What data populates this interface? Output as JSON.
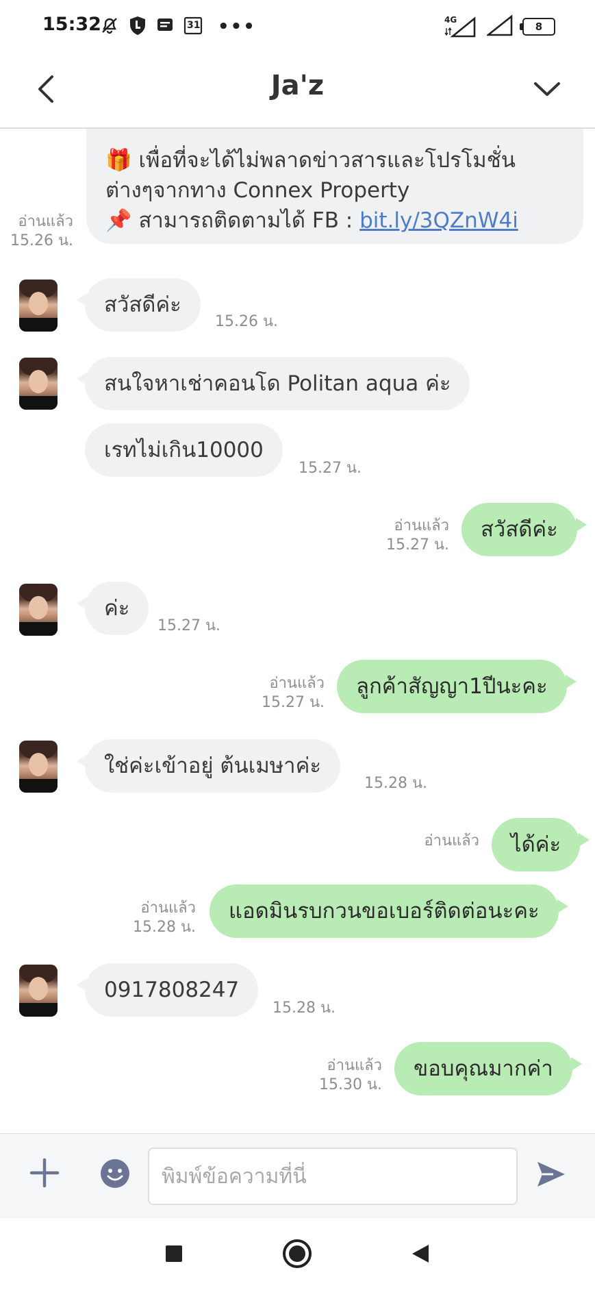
{
  "status_bar": {
    "time": "15:32",
    "left_icons": [
      "mute-icon",
      "shield-icon",
      "message-icon",
      "calendar-icon"
    ],
    "calendar_day": "31",
    "more": "•••",
    "network": "4G",
    "battery": "8"
  },
  "header": {
    "title": "Ja'z"
  },
  "messages": {
    "promo": {
      "line1": "🎁 เพื่อที่จะได้ไม่พลาดข่าวสารและโปรโมชั่น",
      "line2": "ต่างๆจากทาง Connex Property",
      "line3_text": "📌 สามารถติดตามได้ FB : ",
      "line3_link": "bit.ly/3QZnW4i",
      "read": "อ่านแล้ว",
      "time": "15.26 น."
    },
    "m1": {
      "text": "สวัสดีค่ะ",
      "time": "15.26 น."
    },
    "m2": {
      "text": "สนใจหาเช่าคอนโด Politan aqua ค่ะ"
    },
    "m3": {
      "text": "เรทไม่เกิน10000",
      "time": "15.27 น."
    },
    "m4": {
      "text": "สวัสดีค่ะ",
      "read": "อ่านแล้ว",
      "time": "15.27 น."
    },
    "m5": {
      "text": "ค่ะ",
      "time": "15.27 น."
    },
    "m6": {
      "text": "ลูกค้าสัญญา1ปีนะคะ",
      "read": "อ่านแล้ว",
      "time": "15.27 น."
    },
    "m7": {
      "text": "ใช่ค่ะเข้าอยู่ ต้นเมษาค่ะ",
      "time": "15.28 น."
    },
    "m8": {
      "text": "ได้ค่ะ",
      "read": "อ่านแล้ว"
    },
    "m9": {
      "text": "แอดมินรบกวนขอเบอร์ติดต่อนะคะ",
      "read": "อ่านแล้ว",
      "time": "15.28 น."
    },
    "m10": {
      "text": "0917808247",
      "time": "15.28 น."
    },
    "m11": {
      "text": "ขอบคุณมากค่า",
      "read": "อ่านแล้ว",
      "time": "15.30 น."
    }
  },
  "input": {
    "placeholder": "พิมพ์ข้อความที่นี่",
    "value": ""
  },
  "colors": {
    "incoming_bubble": "#f0f1f3",
    "outgoing_bubble": "#b9ebb5",
    "link": "#4f7cc8",
    "icon_accent": "#6b7494"
  }
}
